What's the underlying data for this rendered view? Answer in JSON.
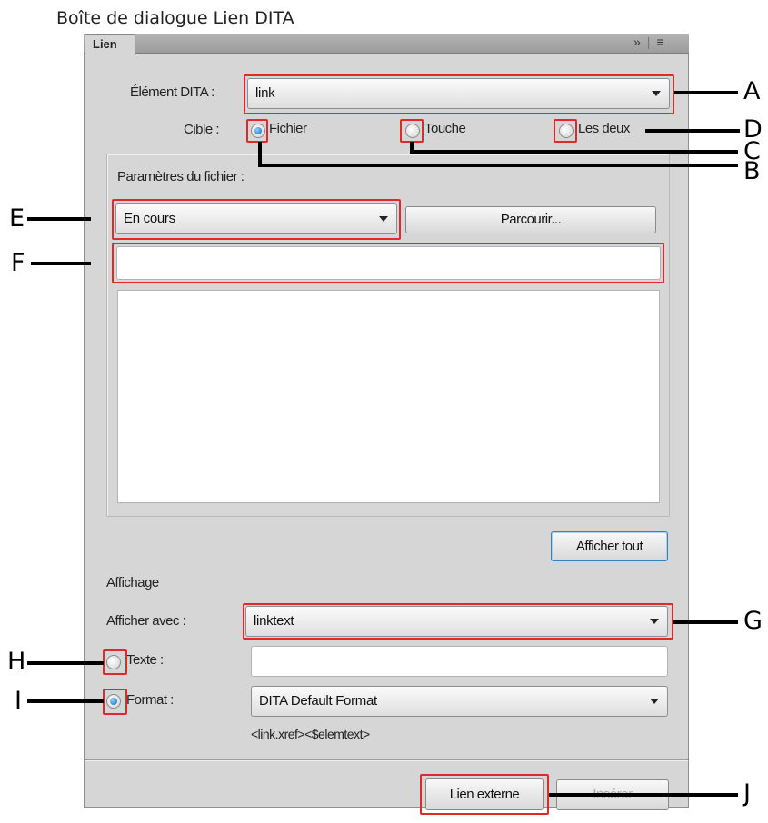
{
  "caption": "Boîte de dialogue Lien DITA",
  "panel": {
    "tab_label": "Lien",
    "tab_menu": "»",
    "tab_menu_sep": "|",
    "tab_menu_icon": "≡"
  },
  "element_dita": {
    "label": "Élément DITA :",
    "value": "link"
  },
  "cible": {
    "label": "Cible :",
    "options": [
      "Fichier",
      "Touche",
      "Les deux"
    ],
    "selected": "Fichier"
  },
  "file_params": {
    "label": "Paramètres du fichier :",
    "scope_value": "En cours",
    "browse_label": "Parcourir...",
    "path_value": ""
  },
  "show_all_label": "Afficher tout",
  "affichage": {
    "heading": "Affichage",
    "display_with_label": "Afficher avec :",
    "display_with_value": "linktext",
    "text_option_label": "Texte :",
    "text_value": "",
    "format_option_label": "Format :",
    "format_value": "DITA Default Format",
    "format_preview": "<link.xref><$elemtext>",
    "selected": "Format"
  },
  "footer": {
    "external_link_label": "Lien externe",
    "insert_label": "Insérer"
  },
  "callouts": [
    "A",
    "B",
    "C",
    "D",
    "E",
    "F",
    "G",
    "H",
    "I",
    "J"
  ],
  "colors": {
    "highlight": "#e02a2a",
    "panel": "#d6d6d6",
    "radio_selected": "#1565b8"
  }
}
